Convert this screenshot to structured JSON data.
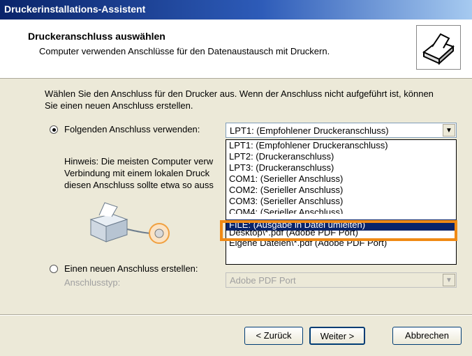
{
  "window": {
    "title": "Druckerinstallations-Assistent"
  },
  "header": {
    "title": "Druckeranschluss auswählen",
    "subtitle": "Computer verwenden Anschlüsse für den Datenaustausch mit Druckern.",
    "icon": "printer-wizard-icon"
  },
  "intro": "Wählen Sie den Anschluss für den Drucker aus. Wenn der Anschluss nicht aufgeführt ist, können Sie einen neuen Anschluss erstellen.",
  "use_existing": {
    "label": "Folgenden Anschluss verwenden:",
    "selected": true,
    "value": "LPT1: (Empfohlener Druckeranschluss)"
  },
  "hint": {
    "line1": "Hinweis: Die meisten Computer verw",
    "line2": "Verbindung mit einem lokalen Druck",
    "line3": "diesen Anschluss sollte etwa so auss"
  },
  "dropdown_items": [
    "LPT1: (Empfohlener Druckeranschluss)",
    "LPT2: (Druckeranschluss)",
    "LPT3: (Druckeranschluss)",
    "COM1: (Serieller Anschluss)",
    "COM2: (Serieller Anschluss)",
    "COM3: (Serieller Anschluss)",
    "COM4: (Serieller Anschluss)",
    "FILE: (Ausgabe in Datei umleiten)",
    "Desktop\\*.pdf (Adobe PDF Port)",
    "Eigene Dateien\\*.pdf (Adobe PDF Port)"
  ],
  "dropdown_selected_index": 7,
  "new_port": {
    "label": "Einen neuen Anschluss erstellen:",
    "type_label": "Anschlusstyp:",
    "type_value": "Adobe PDF Port"
  },
  "buttons": {
    "back": "< Zurück",
    "next": "Weiter >",
    "cancel": "Abbrechen"
  },
  "colors": {
    "highlight": "#f08a15",
    "selection": "#0a246a"
  }
}
